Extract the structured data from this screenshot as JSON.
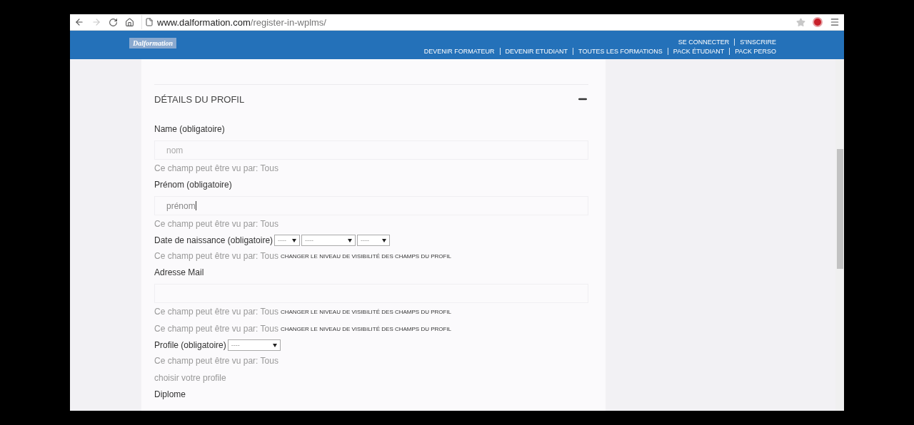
{
  "browser": {
    "url_host": "www.dalformation.com",
    "url_path": "/register-in-wplms/",
    "forward_disabled": true
  },
  "site_header": {
    "logo": "Dalformation",
    "top_links": [
      "SE CONNECTER",
      "S'INSCRIRE"
    ],
    "nav_links": [
      "DEVENIR FORMATEUR",
      "DEVENIR ETUDIANT",
      "TOUTES LES FORMATIONS",
      "PACK ÉTUDIANT",
      "PACK PERSO"
    ]
  },
  "section": {
    "title": "DÉTAILS DU PROFIL",
    "expanded": true
  },
  "fields": [
    {
      "kind": "text",
      "label": "Name (obligatoire)",
      "placeholder": "nom",
      "focused": false,
      "notes": [
        {
          "text": "Ce champ peut être vu par: Tous"
        }
      ]
    },
    {
      "kind": "text",
      "label": "Prénom (obligatoire)",
      "value": "prénom",
      "focused": true,
      "notes": [
        {
          "text": "Ce champ peut être vu par: Tous"
        }
      ]
    },
    {
      "kind": "date",
      "label": "Date de naissance (obligatoire)",
      "selects": [
        "----",
        "----",
        "----"
      ],
      "notes": [
        {
          "text": "Ce champ peut être vu par: Tous",
          "link": "CHANGER LE NIVEAU DE VISIBILITÉ DES CHAMPS DU PROFIL"
        }
      ]
    },
    {
      "kind": "text",
      "label": "Adresse Mail",
      "focused": false,
      "notes": [
        {
          "text": "Ce champ peut être vu par: Tous",
          "link": "CHANGER LE NIVEAU DE VISIBILITÉ DES CHAMPS DU PROFIL"
        },
        {
          "text": "Ce champ peut être vu par: Tous",
          "link": "CHANGER LE NIVEAU DE VISIBILITÉ DES CHAMPS DU PROFIL"
        }
      ]
    },
    {
      "kind": "select",
      "label": "Profile (obligatoire)",
      "selects": [
        "----"
      ],
      "notes": [
        {
          "text": "Ce champ peut être vu par: Tous"
        },
        {
          "text": "choisir votre profile"
        }
      ]
    },
    {
      "kind": "heading",
      "label": "Diplome"
    }
  ]
}
